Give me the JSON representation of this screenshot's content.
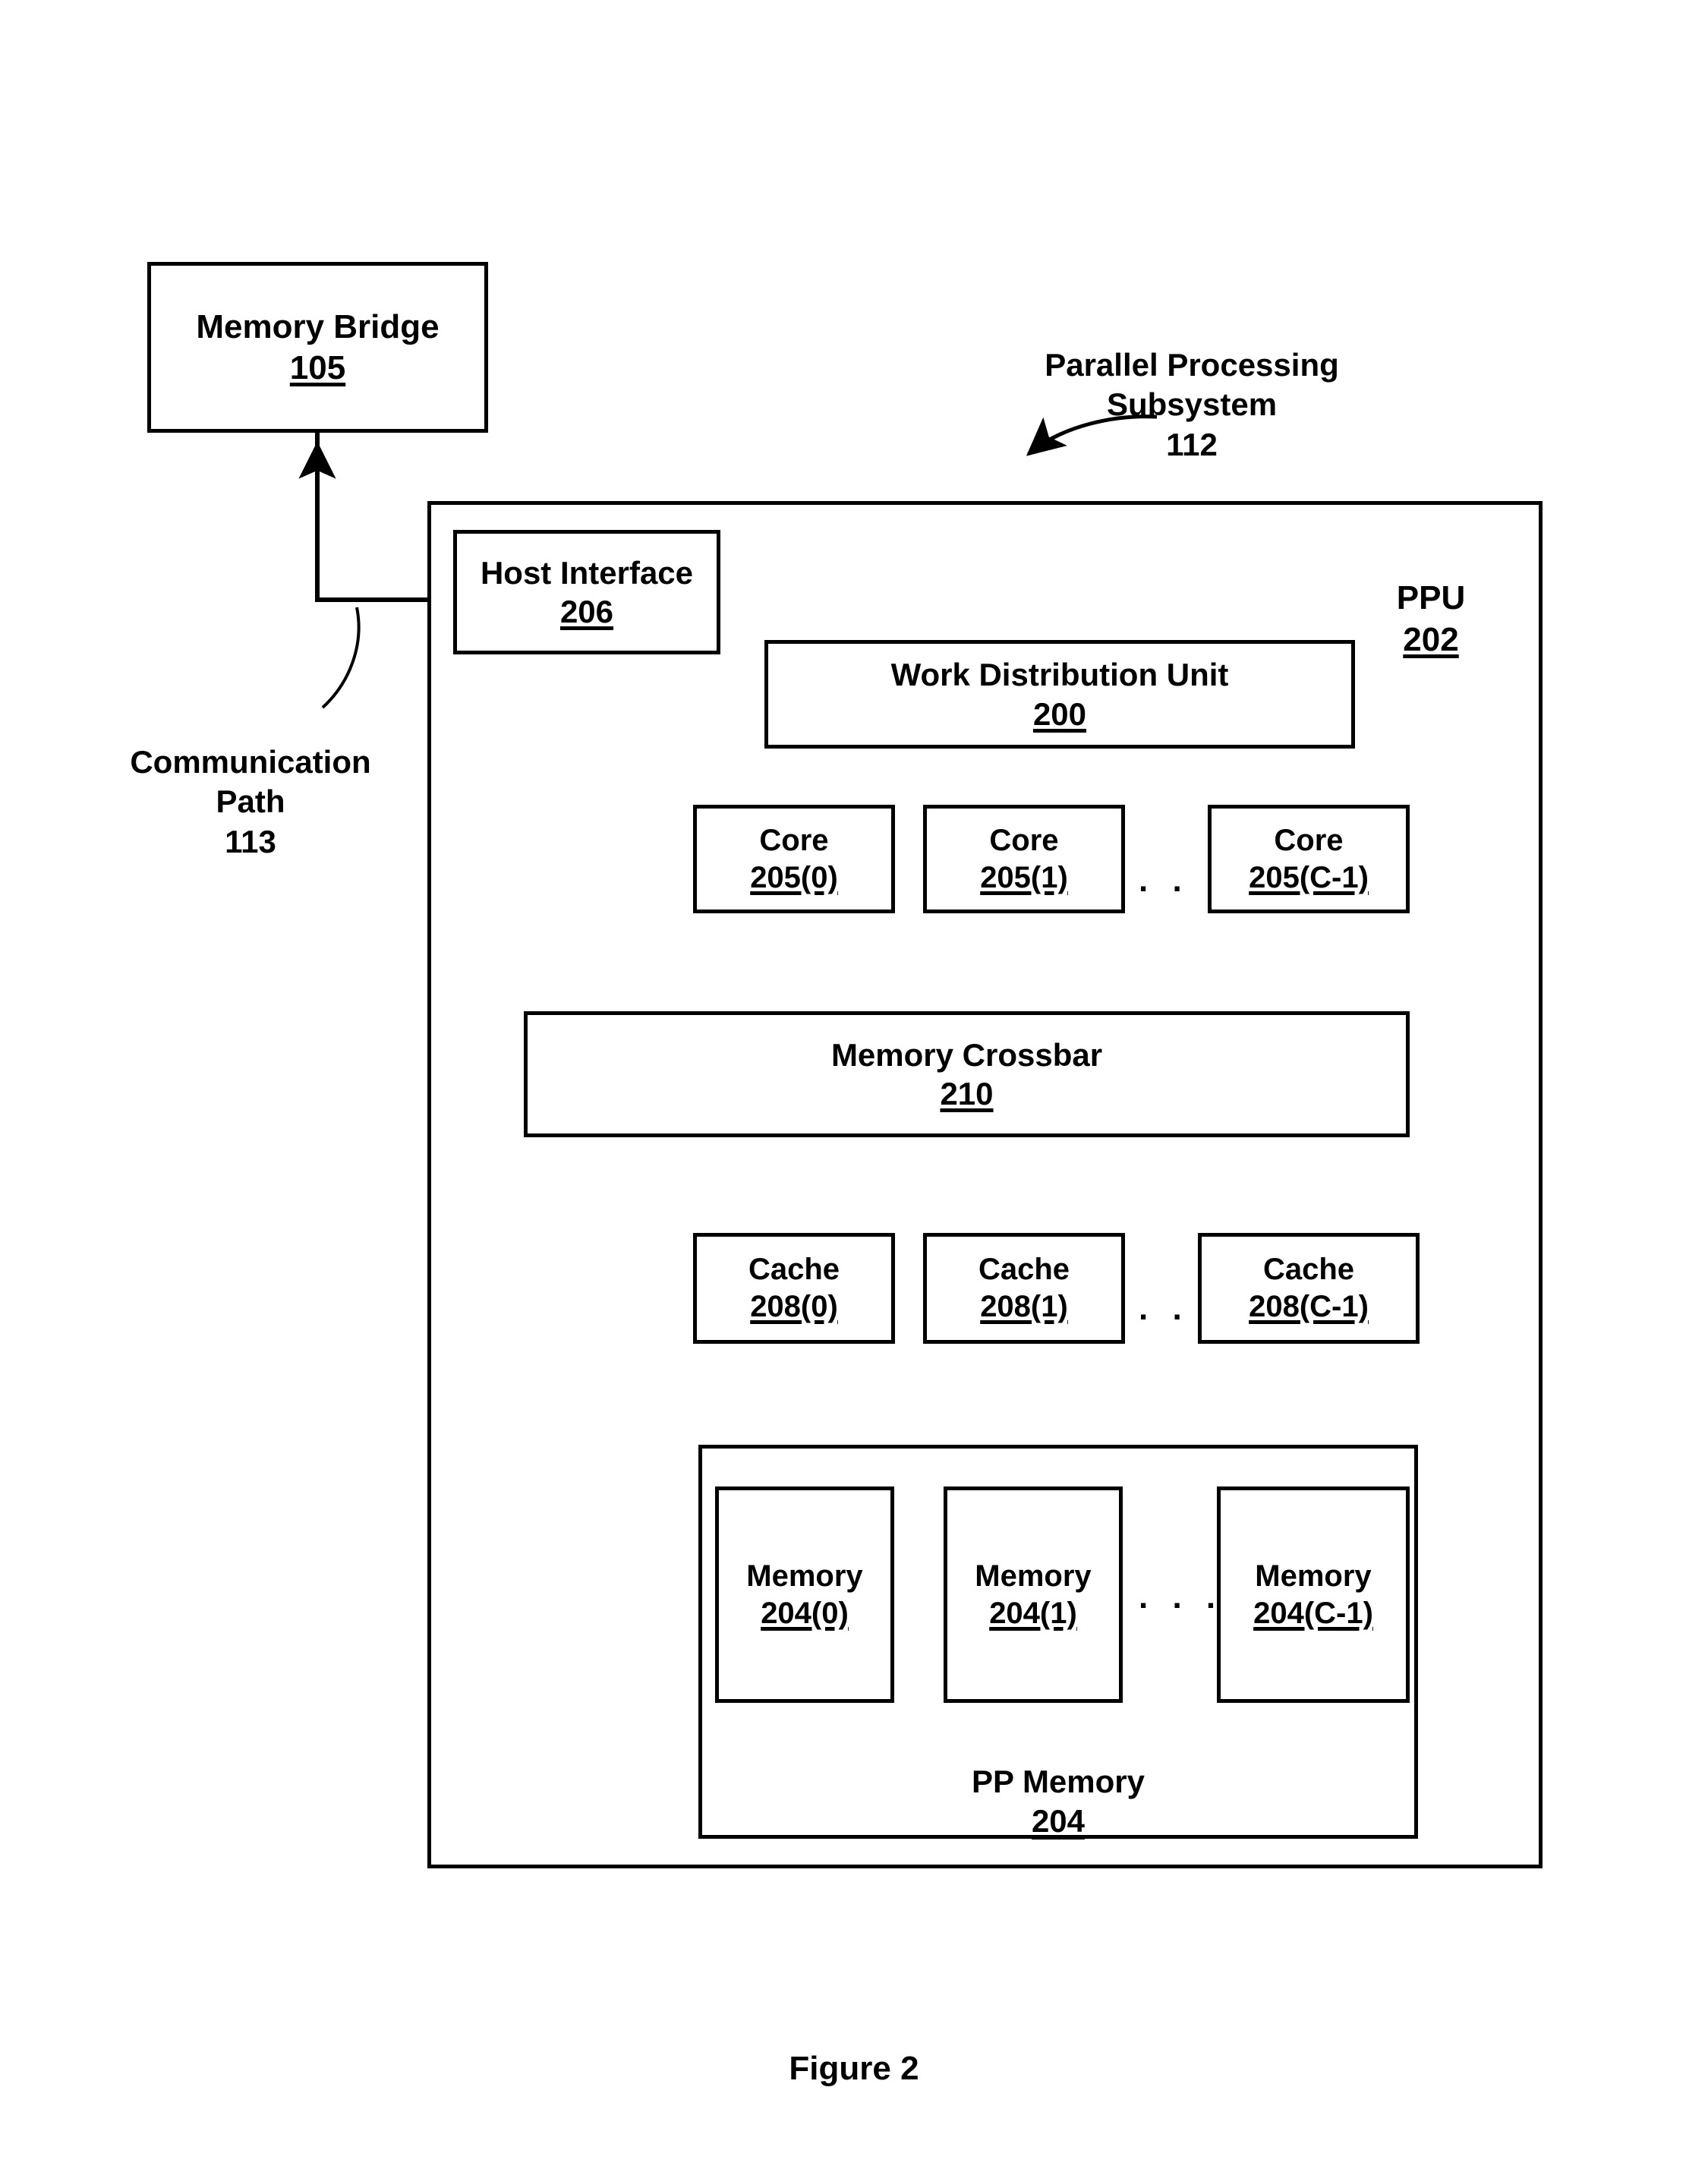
{
  "figure": {
    "caption": "Figure 2"
  },
  "blocks": {
    "memory_bridge": {
      "title": "Memory Bridge",
      "number": "105"
    },
    "host_interface": {
      "title": "Host Interface",
      "number": "206"
    },
    "work_distribution_unit": {
      "title": "Work Distribution Unit",
      "number": "200"
    },
    "memory_crossbar": {
      "title": "Memory Crossbar",
      "number": "210"
    },
    "pp_memory": {
      "title": "PP Memory",
      "number": "204"
    }
  },
  "labels": {
    "parallel_processing_subsystem": {
      "line1": "Parallel Processing",
      "line2": "Subsystem",
      "number": "112"
    },
    "communication_path": {
      "line1": "Communication",
      "line2": "Path",
      "number": "113"
    },
    "ppu": {
      "title": "PPU",
      "number": "202"
    }
  },
  "cores": [
    {
      "title": "Core",
      "number": "205(0)"
    },
    {
      "title": "Core",
      "number": "205(1)"
    },
    {
      "title": "Core",
      "number": "205(C-1)"
    }
  ],
  "caches": [
    {
      "title": "Cache",
      "number": "208(0)"
    },
    {
      "title": "Cache",
      "number": "208(1)"
    },
    {
      "title": "Cache",
      "number": "208(C-1)"
    }
  ],
  "memories": [
    {
      "title": "Memory",
      "number": "204(0)"
    },
    {
      "title": "Memory",
      "number": "204(1)"
    },
    {
      "title": "Memory",
      "number": "204(C-1)"
    }
  ],
  "ellipsis": {
    "core_row": ". . .",
    "cache_row": ". . .",
    "memory_row": ". . ."
  },
  "colors": {
    "stroke": "#000000",
    "background": "#ffffff",
    "text": "#000000"
  }
}
